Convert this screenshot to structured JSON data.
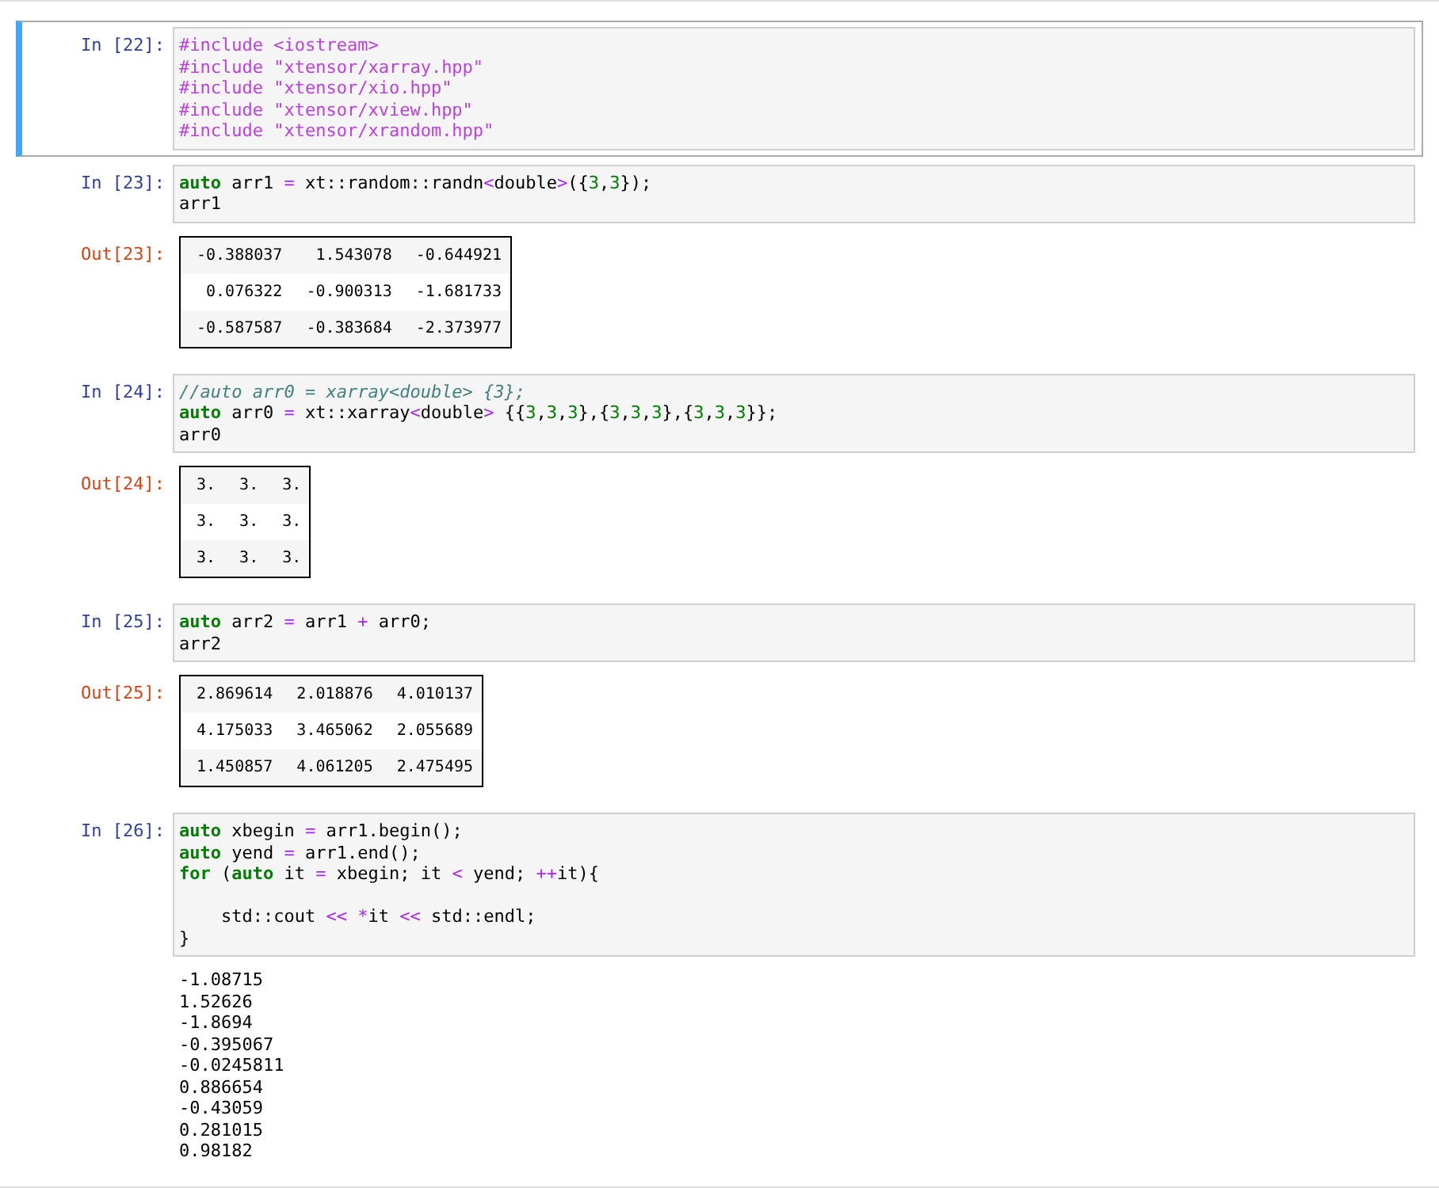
{
  "cells": [
    {
      "prompt": "In [22]:",
      "selected": true,
      "lines": [
        [
          {
            "kind": "preproc",
            "text": "#include <iostream>"
          }
        ],
        [
          {
            "kind": "preproc",
            "text": "#include \"xtensor/xarray.hpp\""
          }
        ],
        [
          {
            "kind": "preproc",
            "text": "#include \"xtensor/xio.hpp\""
          }
        ],
        [
          {
            "kind": "preproc",
            "text": "#include \"xtensor/xview.hpp\""
          }
        ],
        [
          {
            "kind": "preproc",
            "text": "#include \"xtensor/xrandom.hpp\""
          }
        ]
      ]
    },
    {
      "prompt": "In [23]:",
      "selected": false,
      "lines": [
        [
          {
            "kind": "keyword",
            "text": "auto"
          },
          {
            "kind": "plain",
            "text": " arr1 "
          },
          {
            "kind": "operator",
            "text": "="
          },
          {
            "kind": "plain",
            "text": " xt::random::randn"
          },
          {
            "kind": "operator",
            "text": "<"
          },
          {
            "kind": "plain",
            "text": "double"
          },
          {
            "kind": "operator",
            "text": ">"
          },
          {
            "kind": "plain",
            "text": "({"
          },
          {
            "kind": "number",
            "text": "3"
          },
          {
            "kind": "plain",
            "text": ","
          },
          {
            "kind": "number",
            "text": "3"
          },
          {
            "kind": "plain",
            "text": "});"
          }
        ],
        [
          {
            "kind": "plain",
            "text": "arr1"
          }
        ]
      ],
      "output": {
        "kind": "table",
        "prompt": "Out[23]:",
        "rows": [
          [
            "-0.388037",
            "1.543078",
            "-0.644921"
          ],
          [
            "0.076322",
            "-0.900313",
            "-1.681733"
          ],
          [
            "-0.587587",
            "-0.383684",
            "-2.373977"
          ]
        ]
      }
    },
    {
      "prompt": "In [24]:",
      "selected": false,
      "lines": [
        [
          {
            "kind": "comment",
            "text": "//auto arr0 = xarray<double> {3};"
          }
        ],
        [
          {
            "kind": "keyword",
            "text": "auto"
          },
          {
            "kind": "plain",
            "text": " arr0 "
          },
          {
            "kind": "operator",
            "text": "="
          },
          {
            "kind": "plain",
            "text": " xt::xarray"
          },
          {
            "kind": "operator",
            "text": "<"
          },
          {
            "kind": "plain",
            "text": "double"
          },
          {
            "kind": "operator",
            "text": ">"
          },
          {
            "kind": "plain",
            "text": " {{"
          },
          {
            "kind": "number",
            "text": "3"
          },
          {
            "kind": "plain",
            "text": ","
          },
          {
            "kind": "number",
            "text": "3"
          },
          {
            "kind": "plain",
            "text": ","
          },
          {
            "kind": "number",
            "text": "3"
          },
          {
            "kind": "plain",
            "text": "},{"
          },
          {
            "kind": "number",
            "text": "3"
          },
          {
            "kind": "plain",
            "text": ","
          },
          {
            "kind": "number",
            "text": "3"
          },
          {
            "kind": "plain",
            "text": ","
          },
          {
            "kind": "number",
            "text": "3"
          },
          {
            "kind": "plain",
            "text": "},{"
          },
          {
            "kind": "number",
            "text": "3"
          },
          {
            "kind": "plain",
            "text": ","
          },
          {
            "kind": "number",
            "text": "3"
          },
          {
            "kind": "plain",
            "text": ","
          },
          {
            "kind": "number",
            "text": "3"
          },
          {
            "kind": "plain",
            "text": "}};"
          }
        ],
        [
          {
            "kind": "plain",
            "text": "arr0"
          }
        ]
      ],
      "output": {
        "kind": "table",
        "prompt": "Out[24]:",
        "rows": [
          [
            "3.",
            "3.",
            "3."
          ],
          [
            "3.",
            "3.",
            "3."
          ],
          [
            "3.",
            "3.",
            "3."
          ]
        ]
      }
    },
    {
      "prompt": "In [25]:",
      "selected": false,
      "lines": [
        [
          {
            "kind": "keyword",
            "text": "auto"
          },
          {
            "kind": "plain",
            "text": " arr2 "
          },
          {
            "kind": "operator",
            "text": "="
          },
          {
            "kind": "plain",
            "text": " arr1 "
          },
          {
            "kind": "operator",
            "text": "+"
          },
          {
            "kind": "plain",
            "text": " arr0;"
          }
        ],
        [
          {
            "kind": "plain",
            "text": "arr2"
          }
        ]
      ],
      "output": {
        "kind": "table",
        "prompt": "Out[25]:",
        "rows": [
          [
            "2.869614",
            "2.018876",
            "4.010137"
          ],
          [
            "4.175033",
            "3.465062",
            "2.055689"
          ],
          [
            "1.450857",
            "4.061205",
            "2.475495"
          ]
        ]
      }
    },
    {
      "prompt": "In [26]:",
      "selected": false,
      "lines": [
        [
          {
            "kind": "keyword",
            "text": "auto"
          },
          {
            "kind": "plain",
            "text": " xbegin "
          },
          {
            "kind": "operator",
            "text": "="
          },
          {
            "kind": "plain",
            "text": " arr1.begin();"
          }
        ],
        [
          {
            "kind": "keyword",
            "text": "auto"
          },
          {
            "kind": "plain",
            "text": " yend "
          },
          {
            "kind": "operator",
            "text": "="
          },
          {
            "kind": "plain",
            "text": " arr1.end();"
          }
        ],
        [
          {
            "kind": "keyword",
            "text": "for"
          },
          {
            "kind": "plain",
            "text": " ("
          },
          {
            "kind": "keyword",
            "text": "auto"
          },
          {
            "kind": "plain",
            "text": " it "
          },
          {
            "kind": "operator",
            "text": "="
          },
          {
            "kind": "plain",
            "text": " xbegin; it "
          },
          {
            "kind": "operator",
            "text": "<"
          },
          {
            "kind": "plain",
            "text": " yend; "
          },
          {
            "kind": "operator",
            "text": "++"
          },
          {
            "kind": "plain",
            "text": "it){"
          }
        ],
        [
          {
            "kind": "blank"
          }
        ],
        [
          {
            "kind": "plain",
            "text": "    std::cout "
          },
          {
            "kind": "operator",
            "text": "<< *"
          },
          {
            "kind": "plain",
            "text": "it "
          },
          {
            "kind": "operator",
            "text": "<<"
          },
          {
            "kind": "plain",
            "text": " std::endl;"
          }
        ],
        [
          {
            "kind": "plain",
            "text": "}"
          }
        ]
      ],
      "output": {
        "kind": "stream",
        "lines": [
          "-1.08715",
          "1.52626",
          "-1.8694",
          "-0.395067",
          "-0.0245811",
          "0.886654",
          "-0.43059",
          "0.281015",
          "0.98182"
        ]
      }
    }
  ]
}
